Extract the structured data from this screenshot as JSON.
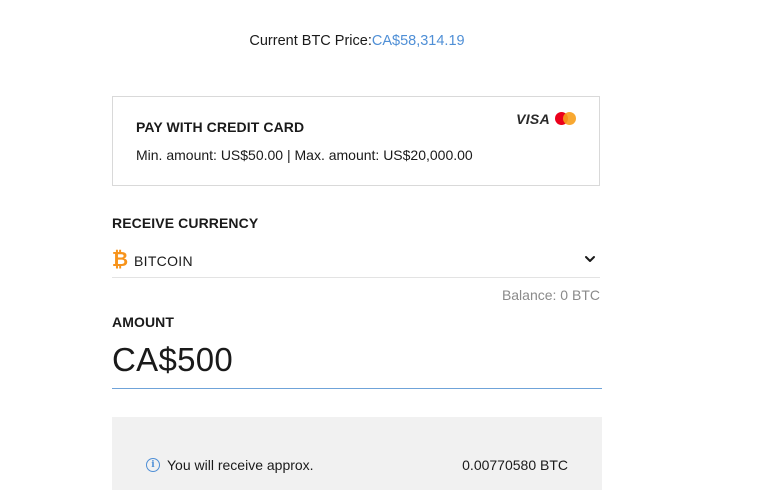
{
  "price": {
    "label": "Current BTC Price:",
    "value": "CA$58,314.19"
  },
  "payment": {
    "title": "PAY WITH CREDIT CARD",
    "limits": "Min. amount: US$50.00 | Max. amount: US$20,000.00",
    "logos": [
      "visa-logo",
      "mastercard-logo"
    ],
    "visa_text": "VISA"
  },
  "receive": {
    "label": "RECEIVE CURRENCY",
    "currency": "BITCOIN",
    "currency_icon": "bitcoin-icon",
    "balance": "Balance: 0 BTC"
  },
  "amount": {
    "label": "AMOUNT",
    "value": "CA$500"
  },
  "estimate": {
    "label": "You will receive approx.",
    "value": "0.00770580 BTC"
  },
  "colors": {
    "accent": "#4f8fd6",
    "bitcoin": "#f7931a",
    "panel_bg": "#f1f1f1"
  }
}
